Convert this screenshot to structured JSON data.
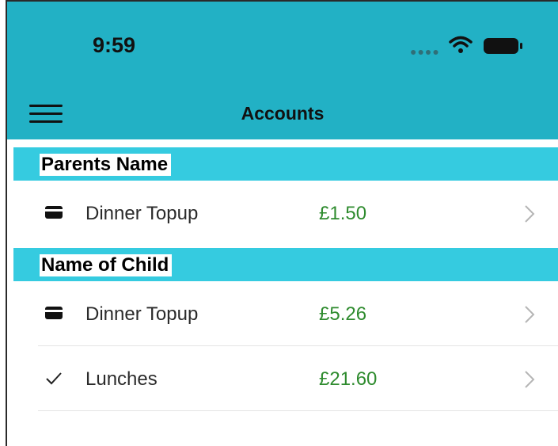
{
  "status_bar": {
    "time": "9:59"
  },
  "nav": {
    "title": "Accounts",
    "menu_icon": "hamburger-menu-icon"
  },
  "colors": {
    "header": "#22b1c5",
    "section": "#35cbe0",
    "amount": "#2e8b2e"
  },
  "sections": [
    {
      "name": "Parents Name",
      "rows": [
        {
          "icon": "card-icon",
          "label": "Dinner Topup",
          "amount": "£1.50"
        }
      ]
    },
    {
      "name": "Name of Child",
      "rows": [
        {
          "icon": "card-icon",
          "label": "Dinner Topup",
          "amount": "£5.26"
        },
        {
          "icon": "checkmark-icon",
          "label": "Lunches",
          "amount": "£21.60"
        }
      ]
    }
  ]
}
